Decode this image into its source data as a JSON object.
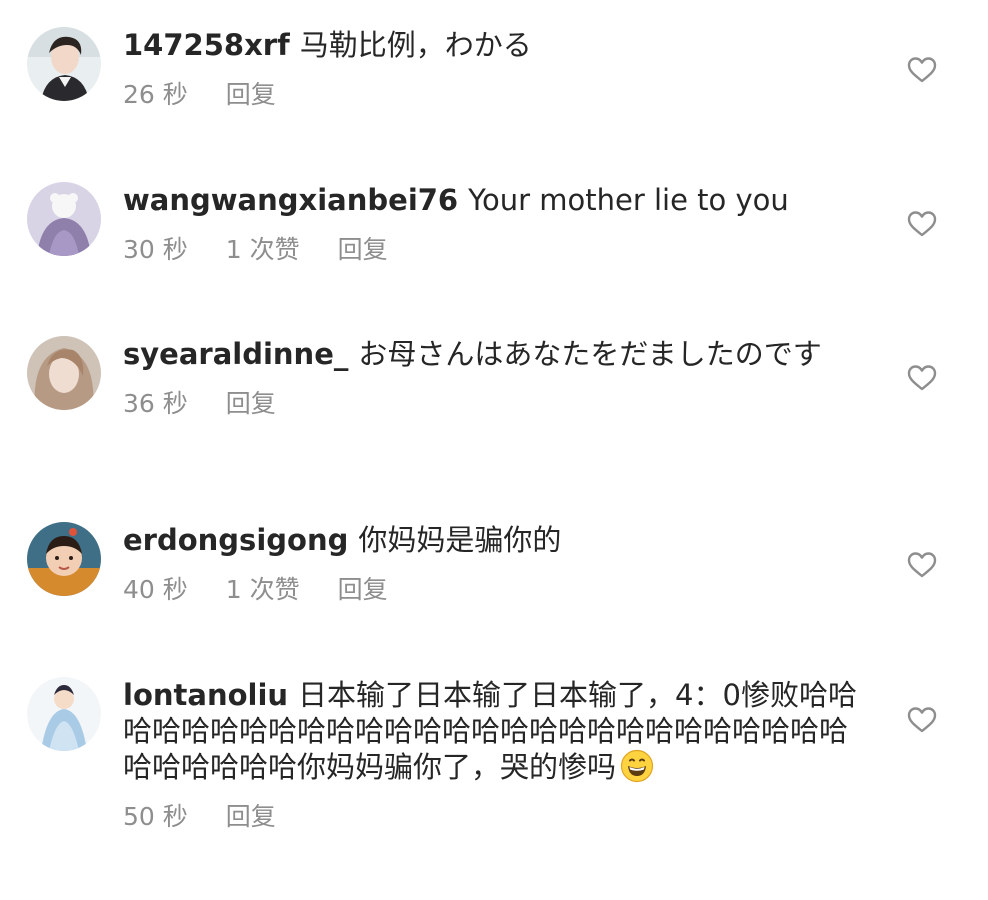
{
  "comments": [
    {
      "username": "147258xrf",
      "text": "马勒比例，わかる",
      "time": "26 秒",
      "likes": "",
      "reply": "回复",
      "like_icon": "heart-outline-icon"
    },
    {
      "username": "wangwangxianbei76",
      "text": "Your mother lie to you",
      "time": "30 秒",
      "likes": "1 次赞",
      "reply": "回复",
      "like_icon": "heart-outline-icon"
    },
    {
      "username": "syearaldinne_",
      "text": "お母さんはあなたをだましたのです",
      "time": "36 秒",
      "likes": "",
      "reply": "回复",
      "like_icon": "heart-outline-icon"
    },
    {
      "username": "erdongsigong",
      "text": "你妈妈是骗你的",
      "time": "40 秒",
      "likes": "1 次赞",
      "reply": "回复",
      "like_icon": "heart-outline-icon"
    },
    {
      "username": "lontanoliu",
      "text": "日本输了日本输了日本输了，4：0惨败哈哈哈哈哈哈哈哈哈哈哈哈哈哈哈哈哈哈哈哈哈哈哈哈哈哈哈哈哈哈哈哈哈你妈妈骗你了，哭的惨吗",
      "emoji": "grinning-face-emoji",
      "time": "50 秒",
      "likes": "",
      "reply": "回复",
      "like_icon": "heart-outline-icon"
    }
  ],
  "colors": {
    "text": "#262626",
    "meta": "#8e8e8e",
    "heart_stroke": "#8e8e8e"
  }
}
